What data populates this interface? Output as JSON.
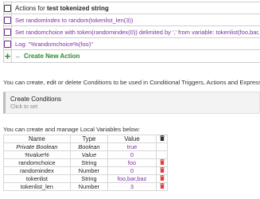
{
  "actions": {
    "header_prefix": "Actions for ",
    "header_name": "test tokenized string",
    "items": [
      "Set randomindex to random(tokenlist_len(3))",
      "Set randomchoice with token(randomindex(0)) delimited by ',' from variable: tokenlist(foo,bar,baz)",
      "Log: \"%randomchoice%(foo)\""
    ],
    "new_action_label": "Create New Action"
  },
  "conditions": {
    "intro_text": "You can create, edit or delete Conditions to be used in Conditional Triggers, Actions and Expressions",
    "create_title": "Create Conditions",
    "create_subtitle": "Click to set"
  },
  "variables": {
    "intro_text": "You can create and manage Local Variables below:",
    "headers": [
      "Name",
      "Type",
      "Value"
    ],
    "rows": [
      {
        "name": "Private Boolean",
        "type": "Boolean",
        "value": "true"
      },
      {
        "name": "%value%",
        "type": "Value",
        "value": "0"
      },
      {
        "name": "randomchoice",
        "type": "String",
        "value": "foo"
      },
      {
        "name": "randomindex",
        "type": "Number",
        "value": "0"
      },
      {
        "name": "tokenlist",
        "type": "String",
        "value": "foo,bar,baz"
      },
      {
        "name": "tokenlist_len",
        "type": "Number",
        "value": "3"
      }
    ]
  },
  "colors": {
    "accent_purple": "#7a2fa0",
    "new_action_green": "#2e8b2e",
    "delete_red": "#e04040"
  }
}
